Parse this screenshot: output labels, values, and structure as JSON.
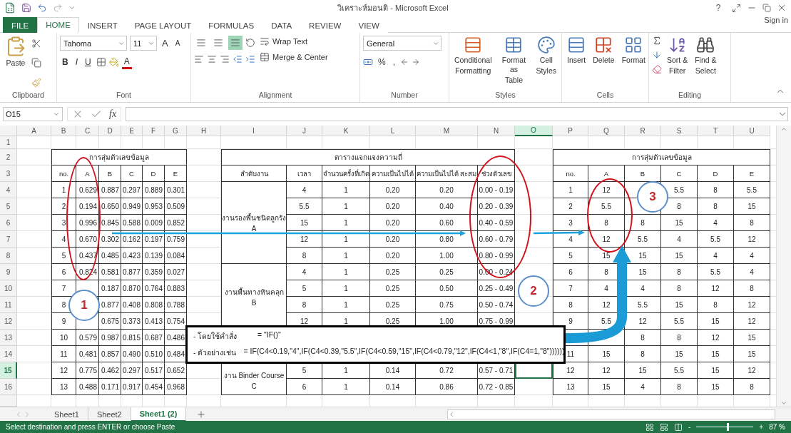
{
  "title_bar": {
    "title": "วิเคราะห์มอนติ - Microsoft Excel",
    "help": "?",
    "sign_in": "Sign in"
  },
  "tabs": [
    {
      "label": "FILE",
      "kind": "file",
      "selected": false
    },
    {
      "label": "HOME",
      "kind": "tab",
      "selected": true
    },
    {
      "label": "INSERT",
      "kind": "tab",
      "selected": false
    },
    {
      "label": "PAGE LAYOUT",
      "kind": "tab",
      "selected": false
    },
    {
      "label": "FORMULAS",
      "kind": "tab",
      "selected": false
    },
    {
      "label": "DATA",
      "kind": "tab",
      "selected": false
    },
    {
      "label": "REVIEW",
      "kind": "tab",
      "selected": false
    },
    {
      "label": "VIEW",
      "kind": "tab",
      "selected": false
    }
  ],
  "ribbon": [
    {
      "kind": "clipboard",
      "name": "Clipboard",
      "paste": "Paste"
    },
    {
      "kind": "font",
      "name": "Font",
      "font": "Tahoma",
      "size": "11",
      "size_buttons": [
        "A",
        "A"
      ],
      "style_buttons": [
        "B",
        "I",
        "U"
      ],
      "color_button": "A"
    },
    {
      "kind": "alignment",
      "name": "Alignment",
      "align_buttons": [
        {
          "selected": false
        },
        {
          "selected": false
        },
        {
          "selected": true
        }
      ],
      "wrap": "Wrap Text",
      "merge": "Merge & Center"
    },
    {
      "kind": "number",
      "name": "Number",
      "format": "General",
      "symbols": [
        "%",
        ","
      ]
    },
    {
      "kind": "buttons",
      "name": "Styles",
      "buttons": [
        {
          "kind": "conditional",
          "lines": [
            "Conditional",
            "Formatting"
          ]
        },
        {
          "kind": "table",
          "lines": [
            "Format as",
            "Table"
          ]
        },
        {
          "kind": "cellstyles",
          "lines": [
            "Cell",
            "Styles"
          ]
        }
      ]
    },
    {
      "kind": "buttons",
      "name": "Cells",
      "buttons": [
        {
          "kind": "insert",
          "lines": [
            "Insert"
          ]
        },
        {
          "kind": "delete",
          "lines": [
            "Delete"
          ]
        },
        {
          "kind": "format",
          "lines": [
            "Format"
          ]
        }
      ]
    },
    {
      "kind": "editing",
      "name": "Editing",
      "buttons": [
        {
          "kind": "sort",
          "lines": [
            "Sort &",
            "Filter"
          ]
        },
        {
          "kind": "find",
          "lines": [
            "Find &",
            "Select"
          ]
        }
      ]
    }
  ],
  "formula_bar": {
    "name_box": "O15",
    "fx": "fx"
  },
  "sheet": {
    "columns": [
      {
        "label": "A",
        "selected": false
      },
      {
        "label": "B",
        "selected": false
      },
      {
        "label": "C",
        "selected": false
      },
      {
        "label": "D",
        "selected": false
      },
      {
        "label": "E",
        "selected": false
      },
      {
        "label": "F",
        "selected": false
      },
      {
        "label": "G",
        "selected": false
      },
      {
        "label": "H",
        "selected": false
      },
      {
        "label": "I",
        "selected": false
      },
      {
        "label": "J",
        "selected": false
      },
      {
        "label": "K",
        "selected": false
      },
      {
        "label": "L",
        "selected": false
      },
      {
        "label": "M",
        "selected": false
      },
      {
        "label": "N",
        "selected": false
      },
      {
        "label": "O",
        "selected": true
      },
      {
        "label": "P",
        "selected": false
      },
      {
        "label": "Q",
        "selected": false
      },
      {
        "label": "R",
        "selected": false
      },
      {
        "label": "S",
        "selected": false
      },
      {
        "label": "T",
        "selected": false
      },
      {
        "label": "U",
        "selected": false
      }
    ],
    "rows": [
      {
        "label": "1",
        "selected": false
      },
      {
        "label": "2",
        "selected": false
      },
      {
        "label": "3",
        "selected": false
      },
      {
        "label": "4",
        "selected": false
      },
      {
        "label": "5",
        "selected": false
      },
      {
        "label": "6",
        "selected": false
      },
      {
        "label": "7",
        "selected": false
      },
      {
        "label": "8",
        "selected": false
      },
      {
        "label": "9",
        "selected": false
      },
      {
        "label": "10",
        "selected": false
      },
      {
        "label": "11",
        "selected": false
      },
      {
        "label": "12",
        "selected": false
      },
      {
        "label": "13",
        "selected": false
      },
      {
        "label": "14",
        "selected": false
      },
      {
        "label": "15",
        "selected": true
      },
      {
        "label": "16",
        "selected": false
      }
    ]
  },
  "tables": [
    {
      "kind": "decimals",
      "title": "การสุ่มตัวเลขข้อมูล",
      "headers": [
        "no.",
        "A",
        "B",
        "C",
        "D",
        "E"
      ],
      "rows": [
        [
          "1",
          "0.629",
          "0.887",
          "0.297",
          "0.889",
          "0.301"
        ],
        [
          "2",
          "0.194",
          "0.650",
          "0.949",
          "0.953",
          "0.509"
        ],
        [
          "3",
          "0.996",
          "0.845",
          "0.588",
          "0.009",
          "0.852"
        ],
        [
          "4",
          "0.670",
          "0.302",
          "0.162",
          "0.197",
          "0.759"
        ],
        [
          "5",
          "0.437",
          "0.485",
          "0.423",
          "0.139",
          "0.084"
        ],
        [
          "6",
          "0.824",
          "0.581",
          "0.877",
          "0.359",
          "0.027"
        ],
        [
          "7",
          null,
          "0.187",
          "0.870",
          "0.764",
          "0.883"
        ],
        [
          "8",
          null,
          "0.877",
          "0.408",
          "0.808",
          "0.788"
        ],
        [
          "9",
          null,
          "0.675",
          "0.373",
          "0.413",
          "0.754"
        ],
        [
          "10",
          "0.579",
          "0.987",
          "0.815",
          "0.687",
          "0.486"
        ],
        [
          "11",
          "0.481",
          "0.857",
          "0.490",
          "0.510",
          "0.484"
        ],
        [
          "12",
          "0.775",
          "0.462",
          "0.297",
          "0.517",
          "0.652"
        ],
        [
          "13",
          "0.488",
          "0.171",
          "0.917",
          "0.454",
          "0.968"
        ]
      ]
    },
    {
      "kind": "frequency",
      "title": "ตารางแจกแจงความถี่",
      "headers": [
        "ลำดับงาน",
        "เวลา",
        "จำนวนครั้งที่เกิด",
        "ความเป็นไปได้",
        "ความเป็นไปได้ สะสม",
        "ช่วงตัวเลข"
      ],
      "groups": [
        {
          "label": "งานรองพื้นชนิดลูกรัง",
          "sub": "A",
          "rows": [
            [
              "4",
              "1",
              "0.20",
              "0.20",
              "0.00 - 0.19"
            ],
            [
              "5.5",
              "1",
              "0.20",
              "0.40",
              "0.20 - 0.39"
            ],
            [
              "15",
              "1",
              "0.20",
              "0.60",
              "0.40 - 0.59"
            ],
            [
              "12",
              "1",
              "0.20",
              "0.80",
              "0.60 - 0.79"
            ],
            [
              "8",
              "1",
              "0.20",
              "1.00",
              "0.80 - 0.99"
            ]
          ]
        },
        {
          "label": "งานพื้นทางหินคลุก",
          "sub": "B",
          "rows": [
            [
              "4",
              "1",
              "0.25",
              "0.25",
              "0.00 - 0.24"
            ],
            [
              "5",
              "1",
              "0.25",
              "0.50",
              "0.25 - 0.49"
            ],
            [
              "8",
              "1",
              "0.25",
              "0.75",
              "0.50 - 0.74"
            ],
            [
              "12",
              "1",
              "0.25",
              "1.00",
              "0.75 - 0.99"
            ]
          ]
        },
        {
          "label": "งาน Binder Course",
          "sub": "C",
          "rows": [
            null,
            null,
            [
              "5",
              "1",
              "0.14",
              "0.72",
              "0.57 - 0.71"
            ],
            [
              "6",
              "1",
              "0.14",
              "0.86",
              "0.72 - 0.85"
            ]
          ]
        }
      ]
    },
    {
      "kind": "values",
      "title": "การสุ่มตัวเลขข้อมูล",
      "headers": [
        "no.",
        "A",
        "B",
        "C",
        "D",
        "E"
      ],
      "rows": [
        [
          "1",
          "12",
          null,
          "5.5",
          "8",
          "5.5"
        ],
        [
          "2",
          "5.5",
          null,
          "8",
          "8",
          "15"
        ],
        [
          "3",
          "8",
          "8",
          "15",
          "4",
          "8"
        ],
        [
          "4",
          "12",
          "5.5",
          "4",
          "5.5",
          "12"
        ],
        [
          "5",
          "15",
          "15",
          "15",
          "4",
          "4"
        ],
        [
          "6",
          "8",
          "15",
          "8",
          "5.5",
          "4"
        ],
        [
          "7",
          "4",
          "4",
          "8",
          "12",
          "8"
        ],
        [
          "8",
          "12",
          "5.5",
          "15",
          "8",
          "12"
        ],
        [
          "9",
          "5.5",
          "12",
          "5.5",
          "15",
          "12"
        ],
        [
          null,
          null,
          "8",
          "8",
          "12",
          "15"
        ],
        [
          "11",
          "15",
          "8",
          "15",
          "15",
          "15"
        ],
        [
          "12",
          "12",
          "15",
          "5.5",
          "15",
          "12"
        ],
        [
          "13",
          "15",
          "4",
          "8",
          "15",
          "8"
        ]
      ]
    }
  ],
  "annotations": {
    "markers": [
      "1",
      "2",
      "3"
    ],
    "callout": {
      "lines": [
        {
          "label": "- โดยใช้คำสั่ง",
          "value": "= \"IF()\""
        },
        {
          "label": "- ตัวอย่างเช่น",
          "value": "= IF(C4<0.19,\"4\",IF(C4<0.39,\"5.5\",IF(C4<0.59,\"15\",IF(C4<0.79,\"12\",IF(C4<1,\"8\",IF(C4=1,\"8\"))))))"
        }
      ]
    }
  },
  "sheet_tabs": [
    {
      "label": "Sheet1",
      "selected": false
    },
    {
      "label": "Sheet2",
      "selected": false
    },
    {
      "label": "Sheet1 (2)",
      "selected": true
    }
  ],
  "status_bar": {
    "message": "Select destination and press ENTER or choose Paste",
    "zoom_out": "-",
    "zoom_in": "+",
    "zoom": "87 %",
    "zoom_level": {
      "level": 0.55
    }
  }
}
